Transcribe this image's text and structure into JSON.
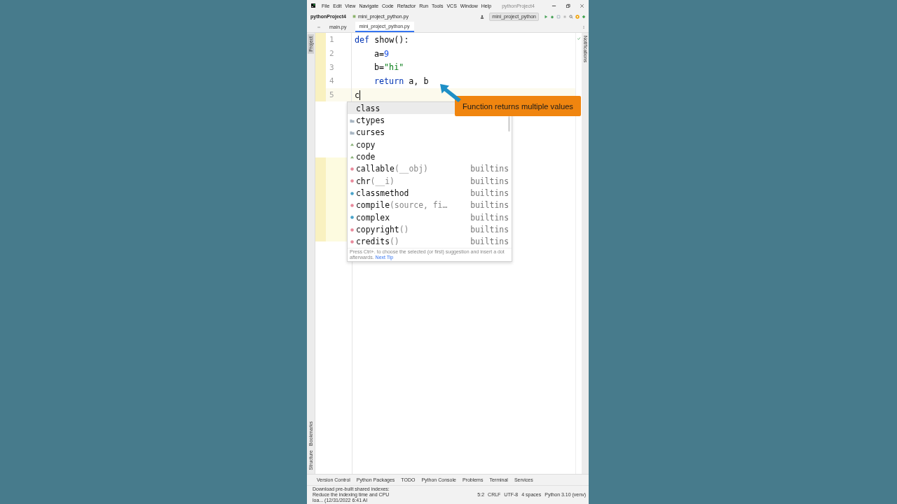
{
  "window": {
    "menu": [
      "File",
      "Edit",
      "View",
      "Navigate",
      "Code",
      "Refactor",
      "Run",
      "Tools",
      "VCS",
      "Window",
      "Help"
    ],
    "title": "pythonProject4"
  },
  "navbar": {
    "project": "pythonProject4",
    "file": "mini_project_python.py",
    "run_config": "mini_project_python"
  },
  "tabs": [
    {
      "label": "main.py",
      "selected": false
    },
    {
      "label": "mini_project_python.py",
      "selected": true
    }
  ],
  "left_strip": {
    "top": [
      {
        "label": "Project",
        "selected": true
      }
    ],
    "bottom": [
      {
        "label": "Bookmarks",
        "selected": false
      },
      {
        "label": "Structure",
        "selected": false
      }
    ]
  },
  "right_strip": [
    "Notifications"
  ],
  "editor": {
    "lines": [
      {
        "number": "1",
        "current": false,
        "indented": false,
        "tokens": [
          {
            "text": "def",
            "kind": "keyword"
          },
          {
            "text": " show():",
            "kind": "plain"
          }
        ]
      },
      {
        "number": "2",
        "current": false,
        "indented": true,
        "tokens": [
          {
            "text": "a=",
            "kind": "plain"
          },
          {
            "text": "9",
            "kind": "number"
          }
        ]
      },
      {
        "number": "3",
        "current": false,
        "indented": true,
        "tokens": [
          {
            "text": "b=",
            "kind": "plain"
          },
          {
            "text": "\"hi\"",
            "kind": "string"
          }
        ]
      },
      {
        "number": "4",
        "current": false,
        "indented": true,
        "tokens": [
          {
            "text": "return",
            "kind": "keyword"
          },
          {
            "text": " a, b",
            "kind": "plain"
          }
        ]
      },
      {
        "number": "5",
        "current": true,
        "indented": false,
        "tokens": [
          {
            "text": "c",
            "kind": "plain"
          }
        ]
      }
    ]
  },
  "completion": {
    "items": [
      {
        "name": "class",
        "kind": "keyword",
        "selected": true
      },
      {
        "name": "ctypes",
        "kind": "package",
        "selected": false
      },
      {
        "name": "curses",
        "kind": "package",
        "selected": false
      },
      {
        "name": "copy",
        "kind": "module",
        "selected": false
      },
      {
        "name": "code",
        "kind": "module",
        "selected": false
      },
      {
        "name": "callable",
        "args": "(__obj)",
        "kind": "function",
        "source": "builtins",
        "selected": false
      },
      {
        "name": "chr",
        "args": "(__i)",
        "kind": "function",
        "source": "builtins",
        "selected": false
      },
      {
        "name": "classmethod",
        "kind": "class",
        "source": "builtins",
        "selected": false
      },
      {
        "name": "compile",
        "args": "(source, fi…",
        "kind": "function",
        "source": "builtins",
        "selected": false
      },
      {
        "name": "complex",
        "kind": "class",
        "source": "builtins",
        "selected": false
      },
      {
        "name": "copyright",
        "args": "()",
        "kind": "function",
        "source": "builtins",
        "selected": false
      },
      {
        "name": "credits",
        "args": "()",
        "kind": "function",
        "source": "builtins",
        "selected": false
      }
    ],
    "hint": "Press Ctrl+. to choose the selected (or first) suggestion and insert a dot afterwards.",
    "hint_link": "Next Tip"
  },
  "callout": "Function returns multiple values",
  "tool_tabs": [
    "Version Control",
    "Python Packages",
    "TODO",
    "Python Console",
    "Problems",
    "Terminal",
    "Services"
  ],
  "status_bar": {
    "message": "Download pre-built shared indexes: Reduce the indexing time and CPU loa... (12/31/2022 6:41 AI",
    "items": [
      "5:2",
      "CRLF",
      "UTF-8",
      "4 spaces",
      "Python 3.10 (venv)"
    ]
  }
}
